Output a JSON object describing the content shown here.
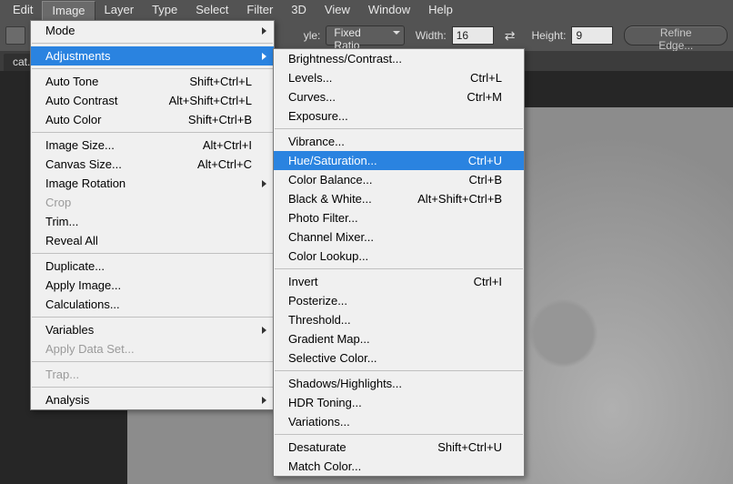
{
  "menubar": {
    "edit": "Edit",
    "image": "Image",
    "layer": "Layer",
    "type": "Type",
    "select": "Select",
    "filter": "Filter",
    "3d": "3D",
    "view": "View",
    "window": "Window",
    "help": "Help"
  },
  "options": {
    "style_label": "yle:",
    "style_value": "Fixed Ratio",
    "width_label": "Width:",
    "width_value": "16",
    "height_label": "Height:",
    "height_value": "9",
    "refine_edge": "Refine Edge..."
  },
  "tabs": {
    "doc1": "cat.jp",
    "close": "×"
  },
  "image_menu": {
    "mode": "Mode",
    "adjustments": "Adjustments",
    "auto_tone": "Auto Tone",
    "auto_tone_sc": "Shift+Ctrl+L",
    "auto_contrast": "Auto Contrast",
    "auto_contrast_sc": "Alt+Shift+Ctrl+L",
    "auto_color": "Auto Color",
    "auto_color_sc": "Shift+Ctrl+B",
    "image_size": "Image Size...",
    "image_size_sc": "Alt+Ctrl+I",
    "canvas_size": "Canvas Size...",
    "canvas_size_sc": "Alt+Ctrl+C",
    "image_rotation": "Image Rotation",
    "crop": "Crop",
    "trim": "Trim...",
    "reveal_all": "Reveal All",
    "duplicate": "Duplicate...",
    "apply_image": "Apply Image...",
    "calculations": "Calculations...",
    "variables": "Variables",
    "apply_data_set": "Apply Data Set...",
    "trap": "Trap...",
    "analysis": "Analysis"
  },
  "adjustments_menu": {
    "brightness_contrast": "Brightness/Contrast...",
    "levels": "Levels...",
    "levels_sc": "Ctrl+L",
    "curves": "Curves...",
    "curves_sc": "Ctrl+M",
    "exposure": "Exposure...",
    "vibrance": "Vibrance...",
    "hue_saturation": "Hue/Saturation...",
    "hue_saturation_sc": "Ctrl+U",
    "color_balance": "Color Balance...",
    "color_balance_sc": "Ctrl+B",
    "black_white": "Black & White...",
    "black_white_sc": "Alt+Shift+Ctrl+B",
    "photo_filter": "Photo Filter...",
    "channel_mixer": "Channel Mixer...",
    "color_lookup": "Color Lookup...",
    "invert": "Invert",
    "invert_sc": "Ctrl+I",
    "posterize": "Posterize...",
    "threshold": "Threshold...",
    "gradient_map": "Gradient Map...",
    "selective_color": "Selective Color...",
    "shadows_highlights": "Shadows/Highlights...",
    "hdr_toning": "HDR Toning...",
    "variations": "Variations...",
    "desaturate": "Desaturate",
    "desaturate_sc": "Shift+Ctrl+U",
    "match_color": "Match Color..."
  }
}
